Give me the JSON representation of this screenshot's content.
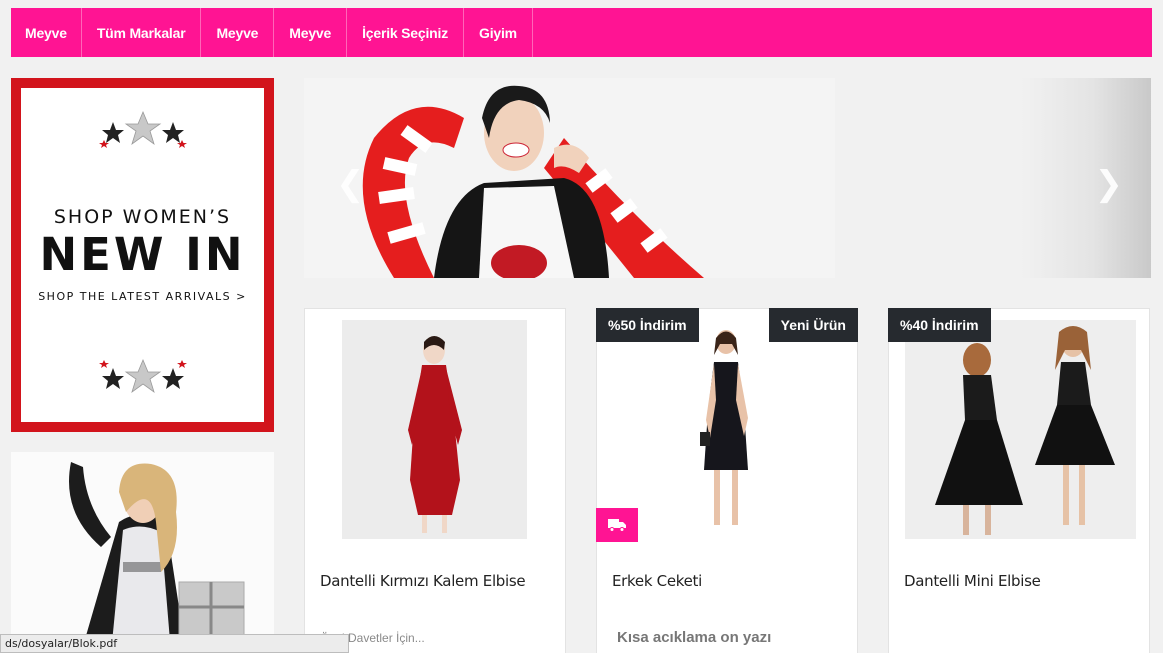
{
  "nav": {
    "items": [
      "Meyve",
      "Tüm Markalar",
      "Meyve",
      "Meyve",
      "İçerik Seçiniz",
      "Giyim"
    ]
  },
  "banner1": {
    "line1": "SHOP WOMEN’S",
    "line2": "NEW IN",
    "line3": "SHOP THE LATEST ARRIVALS >"
  },
  "slider": {
    "prev_icon": "chevron-left-icon",
    "next_icon": "chevron-right-icon",
    "prev_glyph": "❮",
    "next_glyph": "❯"
  },
  "products": [
    {
      "title": "Dantelli Kırmızı Kalem Elbise",
      "desc": "Özel Davetler İçin...",
      "badge_left": "",
      "badge_right": ""
    },
    {
      "title": "Erkek Ceketi",
      "desc": "Kısa acıklama on yazı",
      "badge_left": "%50 İndirim",
      "badge_right": "Yeni Ürün",
      "free_shipping_icon": "truck-icon"
    },
    {
      "title": "Dantelli Mini Elbise",
      "desc": "",
      "badge_left": "%40 İndirim",
      "badge_right": ""
    }
  ],
  "statusbar": {
    "text": "ds/dosyalar/Blok.pdf"
  },
  "colors": {
    "accent": "#ff1493",
    "badge_bg": "#262a2f",
    "banner_red": "#d2141c"
  }
}
